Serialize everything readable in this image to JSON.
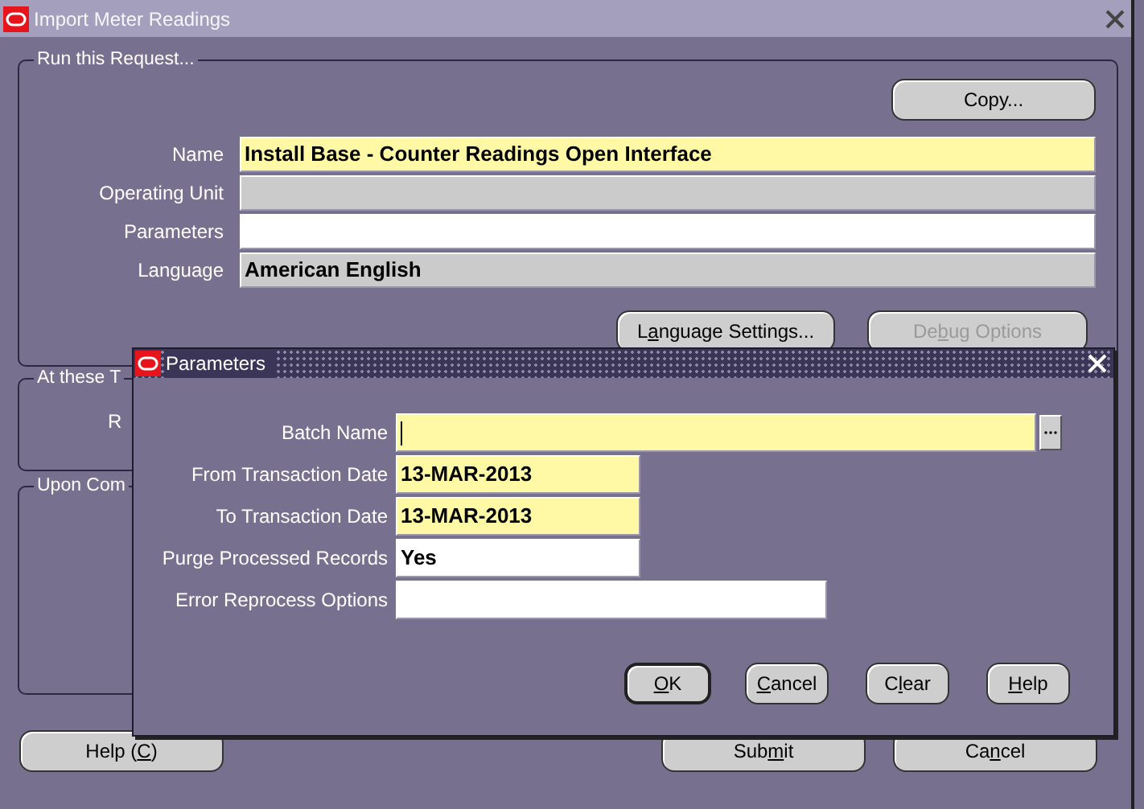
{
  "window": {
    "title": "Import Meter Readings"
  },
  "run_request": {
    "legend": "Run this Request...",
    "copy_button": {
      "label": "Copy..."
    },
    "fields": [
      {
        "label": "Name",
        "value": "Install Base - Counter Readings Open Interface",
        "required": true,
        "readonly": false
      },
      {
        "label": "Operating Unit",
        "required": false,
        "readonly": true
      },
      {
        "label": "Parameters",
        "required": false,
        "readonly": false
      },
      {
        "label": "Language",
        "value": "American English",
        "required": false,
        "readonly": true
      }
    ],
    "buttons": [
      {
        "label": {
          "before": "L",
          "key": "a",
          "after": "nguage Settings..."
        },
        "disabled": false
      },
      {
        "label": {
          "before": "De",
          "key": "b",
          "after": "ug Options"
        },
        "disabled": true
      }
    ]
  },
  "schedule": {
    "legend": "At these T",
    "row_label": "R"
  },
  "completion": {
    "legend": "Upon Com"
  },
  "footer_buttons": [
    {
      "label": {
        "before": "Help (",
        "key": "C",
        "after": ")"
      }
    },
    {
      "label": {
        "before": "Sub",
        "key": "m",
        "after": "it"
      }
    },
    {
      "label": {
        "before": "Ca",
        "key": "n",
        "after": "cel"
      }
    }
  ],
  "dialog": {
    "title": "Parameters",
    "fields": [
      {
        "label": "Batch Name",
        "kind": "lov",
        "required": true,
        "focused": true
      },
      {
        "label": "From Transaction Date",
        "kind": "date",
        "value": "13-MAR-2013",
        "required": true,
        "focused": false
      },
      {
        "label": "To Transaction Date",
        "kind": "date",
        "value": "13-MAR-2013",
        "required": true,
        "focused": false
      },
      {
        "label": "Purge Processed Records",
        "kind": "choice",
        "value": "Yes",
        "required": false,
        "focused": false
      },
      {
        "label": "Error Reprocess Options",
        "kind": "option",
        "required": false,
        "focused": false
      }
    ],
    "buttons": [
      {
        "label": {
          "key": "O",
          "after": "K"
        },
        "default": true
      },
      {
        "label": {
          "key": "C",
          "after": "ancel"
        },
        "default": false
      },
      {
        "label": {
          "before": "C",
          "key": "l",
          "after": "ear"
        },
        "default": false
      },
      {
        "label": {
          "key": "H",
          "after": "elp"
        },
        "default": false
      }
    ]
  }
}
